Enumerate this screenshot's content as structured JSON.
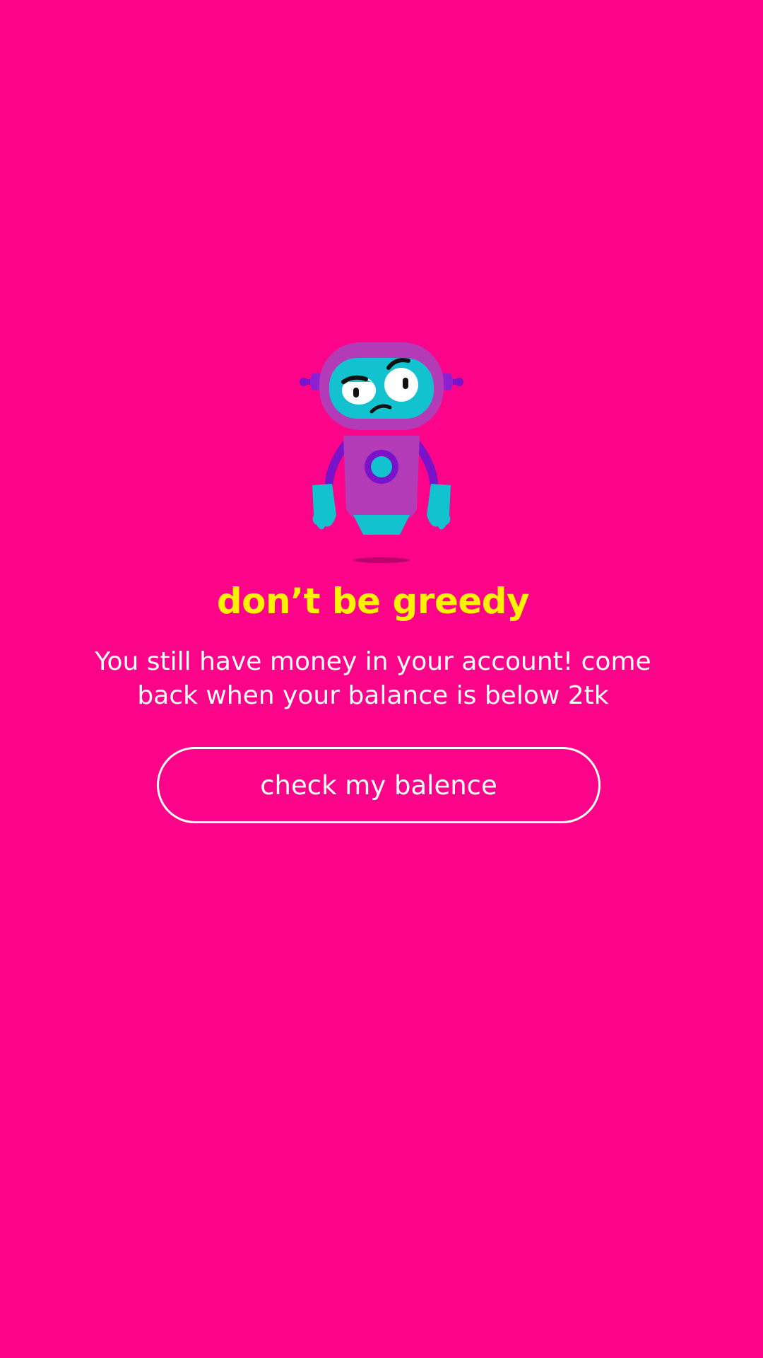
{
  "screen": {
    "background_color": "#FB0489",
    "illustration": "robot-confused-icon"
  },
  "content": {
    "title": "don’t be greedy",
    "title_color": "#FFF200",
    "message": "You still have money in your account! come back when your balance is below 2tk"
  },
  "actions": {
    "check_balance_label": "check my balence"
  }
}
